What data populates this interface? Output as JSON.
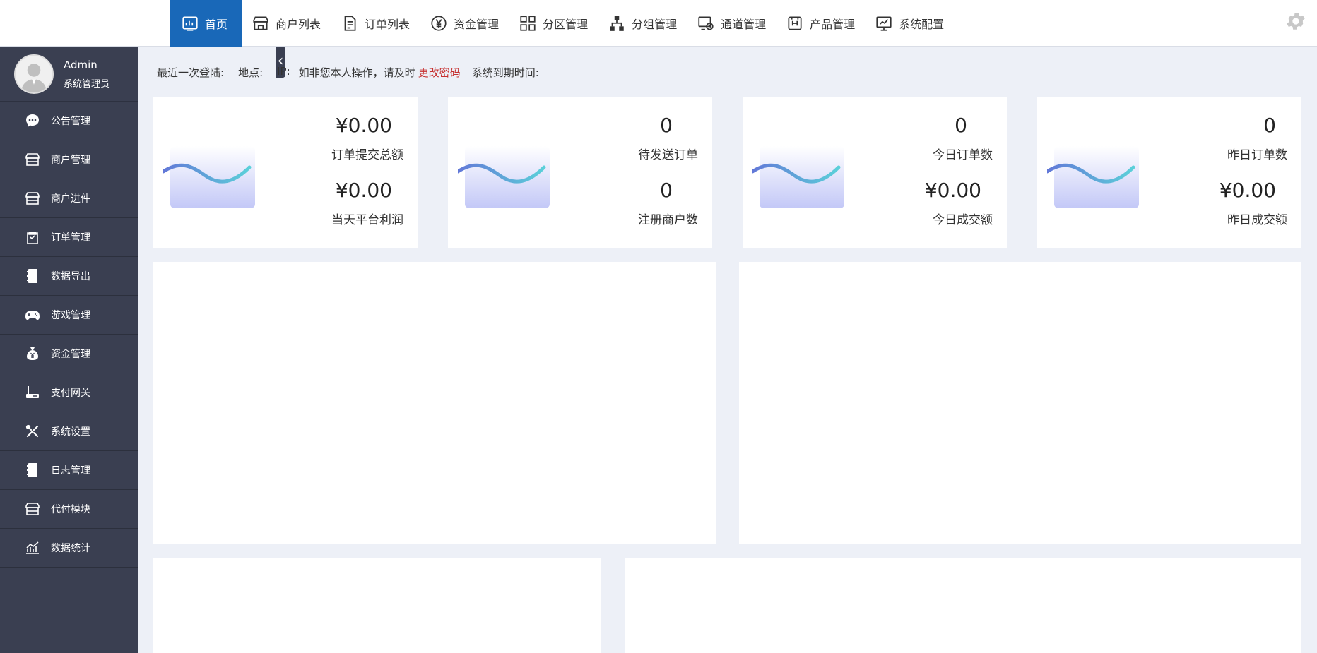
{
  "nav": {
    "items": [
      {
        "label": "首页",
        "icon": "dashboard-icon"
      },
      {
        "label": "商户列表",
        "icon": "store-icon"
      },
      {
        "label": "订单列表",
        "icon": "document-icon"
      },
      {
        "label": "资金管理",
        "icon": "yen-circle-icon"
      },
      {
        "label": "分区管理",
        "icon": "grid-icon"
      },
      {
        "label": "分组管理",
        "icon": "hierarchy-icon"
      },
      {
        "label": "通道管理",
        "icon": "channel-icon"
      },
      {
        "label": "产品管理",
        "icon": "product-icon"
      },
      {
        "label": "系统配置",
        "icon": "monitor-icon"
      }
    ],
    "active_index": 0,
    "accent_color": "#1968b8"
  },
  "user": {
    "name": "Admin",
    "role": "系统管理员"
  },
  "sidebar": {
    "items": [
      {
        "label": "公告管理",
        "icon": "chat-bubble-icon"
      },
      {
        "label": "商户管理",
        "icon": "store-icon"
      },
      {
        "label": "商户进件",
        "icon": "store-icon"
      },
      {
        "label": "订单管理",
        "icon": "clipboard-icon"
      },
      {
        "label": "数据导出",
        "icon": "notebook-icon"
      },
      {
        "label": "游戏管理",
        "icon": "gamepad-icon"
      },
      {
        "label": "资金管理",
        "icon": "money-bag-icon"
      },
      {
        "label": "支付网关",
        "icon": "router-icon"
      },
      {
        "label": "系统设置",
        "icon": "tools-icon"
      },
      {
        "label": "日志管理",
        "icon": "notebook-icon"
      },
      {
        "label": "代付模块",
        "icon": "store-icon"
      },
      {
        "label": "数据统计",
        "icon": "line-chart-icon"
      }
    ],
    "bg_color": "#3a3f51"
  },
  "login_info": {
    "last_login": "最近一次登陆:",
    "location": "地点:",
    "ip": "IP:",
    "notice": "如非您本人操作，请及时",
    "change_password": "更改密码",
    "expiry": "系统到期时间:"
  },
  "stats": [
    {
      "value1": "¥0.00",
      "label1": "订单提交总额",
      "value2": "¥0.00",
      "label2": "当天平台利润"
    },
    {
      "value1": "0",
      "label1": "待发送订单",
      "value2": "0",
      "label2": "注册商户数"
    },
    {
      "value1": "0",
      "label1": "今日订单数",
      "value2": "¥0.00",
      "label2": "今日成交额"
    },
    {
      "value1": "0",
      "label1": "昨日订单数",
      "value2": "¥0.00",
      "label2": "昨日成交额"
    }
  ]
}
